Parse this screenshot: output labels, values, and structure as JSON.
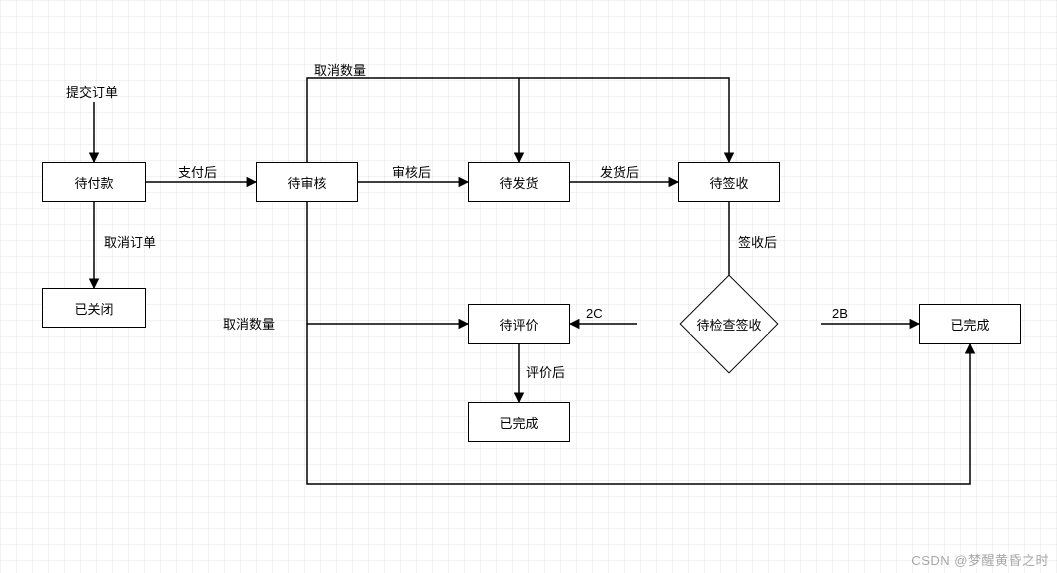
{
  "nodes": {
    "start_label": "提交订单",
    "pending_payment": "待付款",
    "closed": "已关闭",
    "pending_review": "待审核",
    "pending_ship": "待发货",
    "pending_receipt": "待签收",
    "pending_evaluate": "待评价",
    "check_receipt": "待检查签收",
    "completed_small": "已完成",
    "completed_big": "已完成"
  },
  "edges": {
    "cancel_order": "取消订单",
    "after_payment": "支付后",
    "after_review": "审核后",
    "after_ship": "发货后",
    "after_receipt": "签收后",
    "cancel_qty_top": "取消数量",
    "cancel_qty_left": "取消数量",
    "branch_2c": "2C",
    "branch_2b": "2B",
    "after_evaluate": "评价后"
  },
  "watermark": "CSDN @梦醒黄昏之时"
}
